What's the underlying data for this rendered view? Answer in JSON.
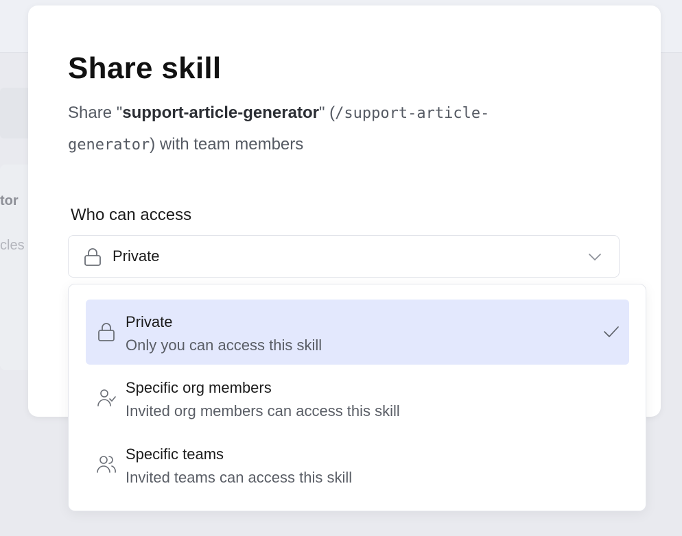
{
  "background": {
    "partial_text_1": "tor",
    "partial_text_2": "cles"
  },
  "modal": {
    "title": "Share skill",
    "description": {
      "prefix": "Share \"",
      "skill_name": "support-article-generator",
      "middle": "\" (",
      "skill_path": "/support-article-generator",
      "suffix": ") with team members"
    },
    "access_label": "Who can access",
    "select": {
      "selected_value": "Private",
      "icon": "lock-icon",
      "expanded": true
    }
  },
  "dropdown": {
    "options": [
      {
        "title": "Private",
        "description": "Only you can access this skill",
        "icon": "lock-icon",
        "selected": true
      },
      {
        "title": "Specific org members",
        "description": "Invited org members can access this skill",
        "icon": "user-check-icon",
        "selected": false
      },
      {
        "title": "Specific teams",
        "description": "Invited teams can access this skill",
        "icon": "users-icon",
        "selected": false
      }
    ]
  },
  "colors": {
    "selected_option_bg": "#e3e8fd",
    "page_bg": "#e9eaef",
    "modal_bg": "#ffffff"
  }
}
